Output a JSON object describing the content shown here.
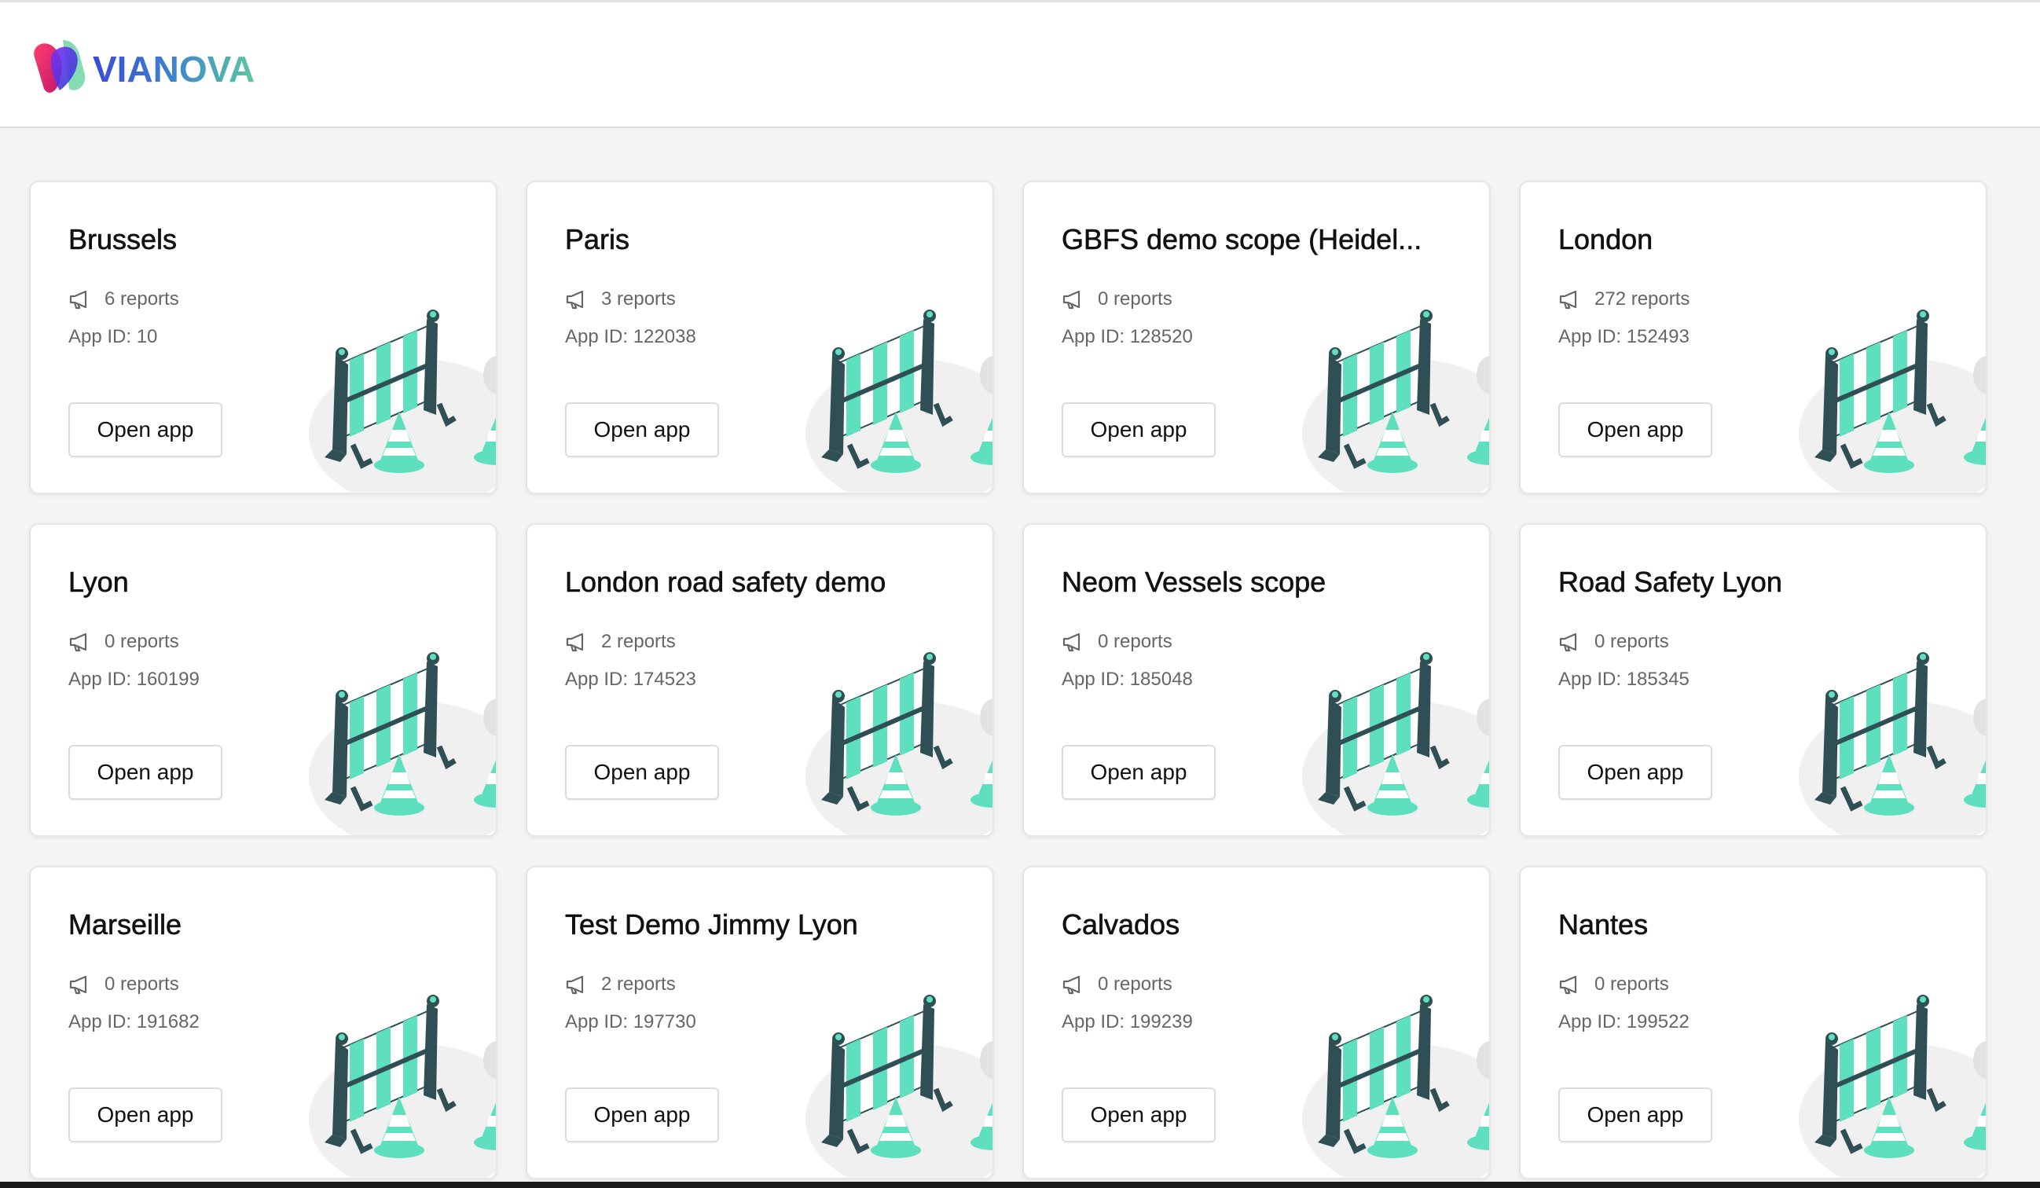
{
  "brand": {
    "name": "VIANOVA",
    "colors": {
      "gradient_start": "#3a4bd6",
      "gradient_end": "#5bc7a0",
      "mark_pink": "#e8356d",
      "mark_purple": "#6a2bd9",
      "mark_green": "#5fcf9a"
    }
  },
  "icons": {
    "reports": "megaphone-icon",
    "illustration": "road-barrier-illustration"
  },
  "accent": {
    "barrier_stripe": "#5ee0bf",
    "barrier_frame": "#2f4f55",
    "ground": "#f0f0f0"
  },
  "cards": [
    {
      "title": "Brussels",
      "reports": "6 reports",
      "app_id": "App ID: 10",
      "button": "Open app"
    },
    {
      "title": "Paris",
      "reports": "3 reports",
      "app_id": "App ID: 122038",
      "button": "Open app"
    },
    {
      "title": "GBFS demo scope (Heidel...",
      "reports": "0 reports",
      "app_id": "App ID: 128520",
      "button": "Open app"
    },
    {
      "title": "London",
      "reports": "272 reports",
      "app_id": "App ID: 152493",
      "button": "Open app"
    },
    {
      "title": "Lyon",
      "reports": "0 reports",
      "app_id": "App ID: 160199",
      "button": "Open app"
    },
    {
      "title": "London road safety demo",
      "reports": "2 reports",
      "app_id": "App ID: 174523",
      "button": "Open app"
    },
    {
      "title": "Neom Vessels scope",
      "reports": "0 reports",
      "app_id": "App ID: 185048",
      "button": "Open app"
    },
    {
      "title": "Road Safety Lyon",
      "reports": "0 reports",
      "app_id": "App ID: 185345",
      "button": "Open app"
    },
    {
      "title": "Marseille",
      "reports": "0 reports",
      "app_id": "App ID: 191682",
      "button": "Open app"
    },
    {
      "title": "Test Demo Jimmy Lyon",
      "reports": "2 reports",
      "app_id": "App ID: 197730",
      "button": "Open app"
    },
    {
      "title": "Calvados",
      "reports": "0 reports",
      "app_id": "App ID: 199239",
      "button": "Open app"
    },
    {
      "title": "Nantes",
      "reports": "0 reports",
      "app_id": "App ID: 199522",
      "button": "Open app"
    }
  ]
}
